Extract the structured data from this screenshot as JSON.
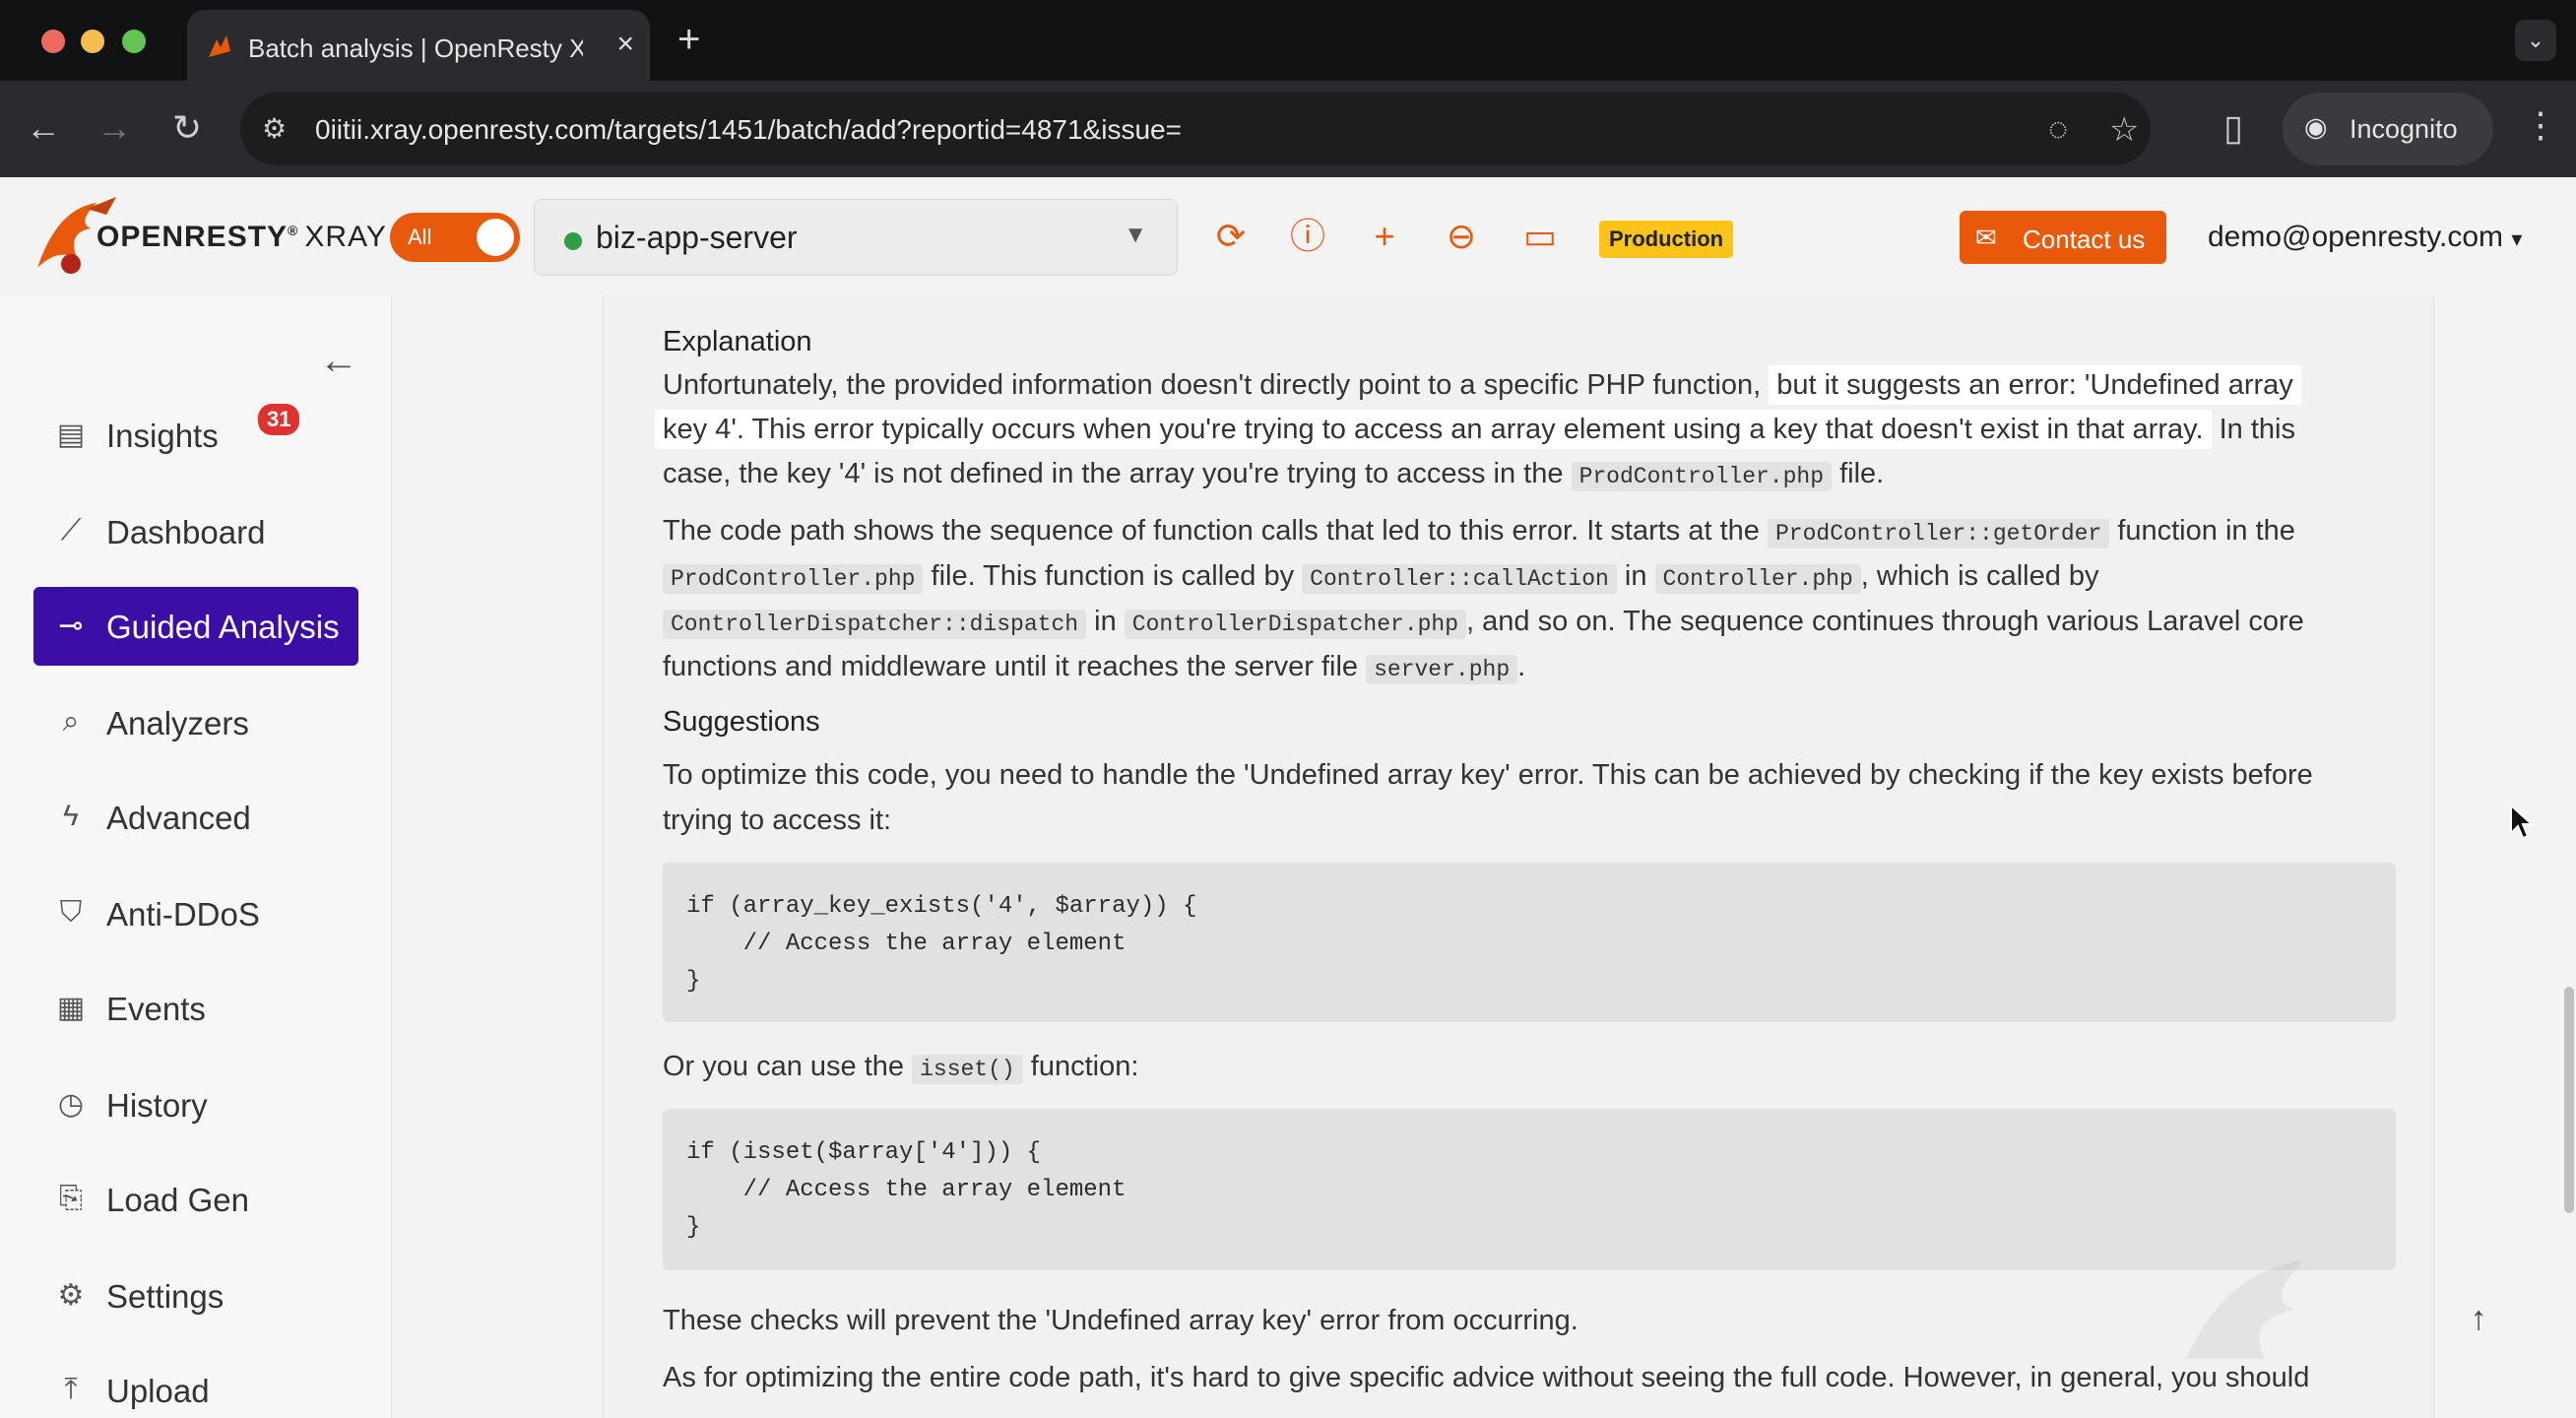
{
  "browser": {
    "tab_title": "Batch analysis | OpenResty X",
    "url": "0iitii.xray.openresty.com/targets/1451/batch/add?reportid=4871&issue=",
    "incognito_label": "Incognito"
  },
  "header": {
    "logo_text": "OPENRESTY",
    "logo_suffix": "XRAY",
    "toggle_label": "All",
    "server": "biz-app-server",
    "env_badge": "Production",
    "contact_label": "Contact us",
    "user": "demo@openresty.com"
  },
  "sidebar": {
    "items": [
      {
        "label": "Insights",
        "icon": "document-icon",
        "badge": "31"
      },
      {
        "label": "Dashboard",
        "icon": "chart-line-icon"
      },
      {
        "label": "Guided Analysis",
        "icon": "guided-icon"
      },
      {
        "label": "Analyzers",
        "icon": "magnifier-icon"
      },
      {
        "label": "Advanced",
        "icon": "bolt-icon"
      },
      {
        "label": "Anti-DDoS",
        "icon": "shield-icon"
      },
      {
        "label": "Events",
        "icon": "calendar-icon"
      },
      {
        "label": "History",
        "icon": "clock-icon"
      },
      {
        "label": "Load Gen",
        "icon": "loadgen-icon"
      },
      {
        "label": "Settings",
        "icon": "gear-icon"
      },
      {
        "label": "Upload",
        "icon": "upload-icon"
      }
    ]
  },
  "content": {
    "explanation_heading": "Explanation",
    "p1_a": "Unfortunately, the provided information doesn't directly point to a specific PHP function,",
    "p1_b": "but it suggests an error: 'Undefined array",
    "p1_c": "key 4'. This error typically occurs when you're trying to access an array element using a key that doesn't exist in that array.",
    "p1_d": "In this",
    "p1_e": "case, the key '4' is not defined in the array you're trying to access in the",
    "p1_code1": "ProdController.php",
    "p1_f": "file.",
    "p2_a": "The code path shows the sequence of function calls that led to this error. It starts at the",
    "p2_code1": "ProdController::getOrder",
    "p2_b": "function in the",
    "p2_code2": "ProdController.php",
    "p2_c": "file. This function is called by",
    "p2_code3": "Controller::callAction",
    "p2_d": "in",
    "p2_code4": "Controller.php",
    "p2_e": ", which is called by",
    "p2_code5": "ControllerDispatcher::dispatch",
    "p2_f": "in",
    "p2_code6": "ControllerDispatcher.php",
    "p2_g": ", and so on. The sequence continues through various Laravel core",
    "p2_h": "functions and middleware until it reaches the server file",
    "p2_code7": "server.php",
    "p2_i": ".",
    "suggestions_heading": "Suggestions",
    "s1_a": "To optimize this code, you need to handle the 'Undefined array key' error. This can be achieved by checking if the key exists before",
    "s1_b": "trying to access it:",
    "code_block_1": "if (array_key_exists('4', $array)) {\n    // Access the array element\n}",
    "s2_a": "Or you can use the",
    "s2_code": "isset()",
    "s2_b": "function:",
    "code_block_2": "if (isset($array['4'])) {\n    // Access the array element\n}",
    "s3": "These checks will prevent the 'Undefined array key' error from occurring.",
    "s4": "As for optimizing the entire code path, it's hard to give specific advice without seeing the full code. However, in general, you should"
  },
  "colors": {
    "accent": "#e8590c",
    "active_nav": "#3b0fa5",
    "badge": "#e03131",
    "production": "#fcc419"
  }
}
